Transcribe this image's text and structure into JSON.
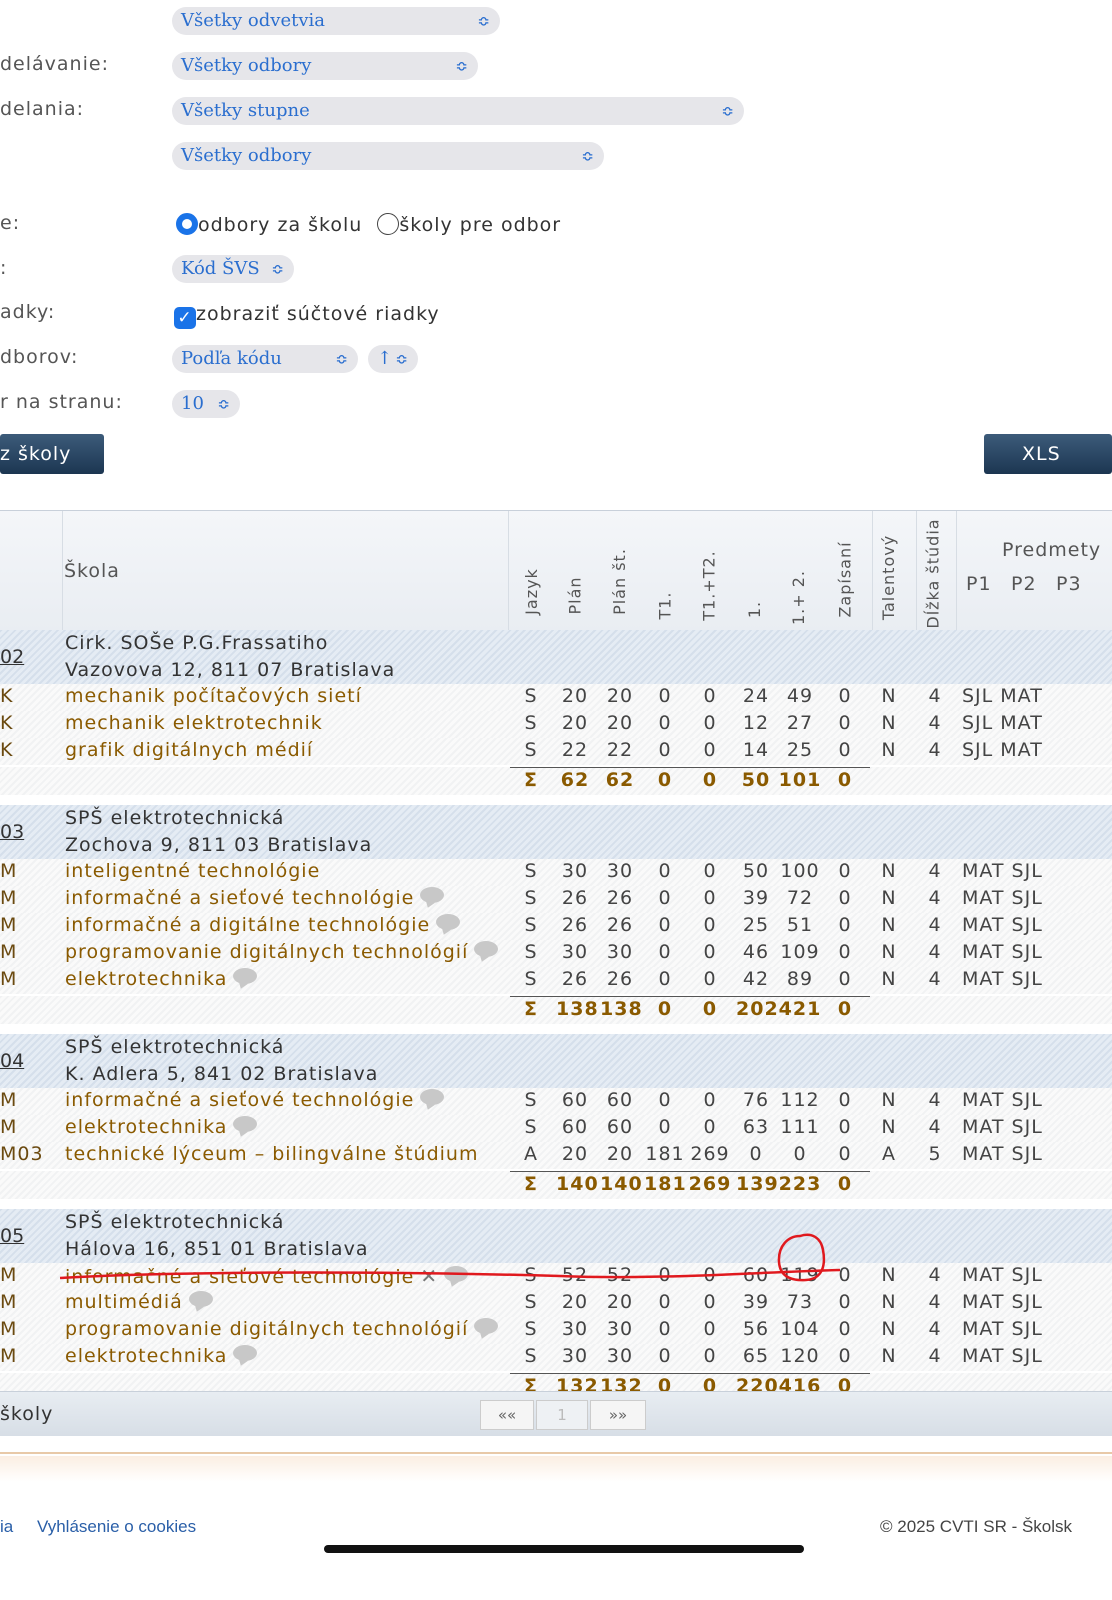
{
  "filters": {
    "select_odvetvia": "Všetky odvetvia",
    "label_vzdelavanie": "delávanie:",
    "select_odbory1": "Všetky odbory",
    "label_vzdelania": "delania:",
    "select_stupne": "Všetky stupne",
    "select_odbory2": "Všetky odbory",
    "label_zobrazenie": "e:",
    "radio1_label": "odbory za školu",
    "radio2_label": "školy pre odbor",
    "label_kod": ":",
    "select_kod": "Kód ŠVS",
    "label_riadky": "adky:",
    "checkbox_label": "zobraziť súčtové riadky",
    "label_odborov": "dborov:",
    "select_order": "Podľa kódu",
    "select_dir": "↑",
    "label_strana": "r na stranu:",
    "select_per_page": "10",
    "button_left": "z školy",
    "button_xls": "XLS"
  },
  "table": {
    "headers": {
      "skola": "Škola",
      "jazyk": "Jazyk",
      "plan": "Plán",
      "plan_st": "Plán št.",
      "t1": "T1.",
      "t1t2": "T1.+T2.",
      "k1": "1.",
      "k12": "1.+ 2.",
      "zapisani": "Zapísaní",
      "talentovy": "Talentový",
      "dlzka": "Dĺžka štúdia",
      "predmety": "Predmety",
      "p1": "P1",
      "p2": "P2",
      "p3": "P3"
    },
    "schools": [
      {
        "id": "02",
        "name": "Cirk. SOŠe P.G.Frassatiho",
        "address": "Vazovova 12, 811 07  Bratislava",
        "rows": [
          {
            "code": "K",
            "name": "mechanik počítačových sietí",
            "jazyk": "S",
            "plan": "20",
            "plan_st": "20",
            "t1": "0",
            "t1t2": "0",
            "k1": "24",
            "k12": "49",
            "zap": "0",
            "tal": "N",
            "dlzka": "4",
            "pred": "SJL MAT"
          },
          {
            "code": "K",
            "name": "mechanik elektrotechnik",
            "jazyk": "S",
            "plan": "20",
            "plan_st": "20",
            "t1": "0",
            "t1t2": "0",
            "k1": "12",
            "k12": "27",
            "zap": "0",
            "tal": "N",
            "dlzka": "4",
            "pred": "SJL MAT"
          },
          {
            "code": "K",
            "name": "grafik digitálnych médií",
            "jazyk": "S",
            "plan": "22",
            "plan_st": "22",
            "t1": "0",
            "t1t2": "0",
            "k1": "14",
            "k12": "25",
            "zap": "0",
            "tal": "N",
            "dlzka": "4",
            "pred": "SJL MAT"
          }
        ],
        "sum": {
          "sigma": "Σ",
          "plan": "62",
          "plan_st": "62",
          "t1": "0",
          "t1t2": "0",
          "k1": "50",
          "k12": "101",
          "zap": "0"
        }
      },
      {
        "id": "03",
        "name": "SPŠ elektrotechnická",
        "address": "Zochova 9, 811 03  Bratislava",
        "rows": [
          {
            "code": "M",
            "name": "inteligentné technológie",
            "jazyk": "S",
            "plan": "30",
            "plan_st": "30",
            "t1": "0",
            "t1t2": "0",
            "k1": "50",
            "k12": "100",
            "zap": "0",
            "tal": "N",
            "dlzka": "4",
            "pred": "MAT SJL"
          },
          {
            "code": "M",
            "name": "informačné a sieťové technológie",
            "jazyk": "S",
            "plan": "26",
            "plan_st": "26",
            "t1": "0",
            "t1t2": "0",
            "k1": "39",
            "k12": "72",
            "zap": "0",
            "tal": "N",
            "dlzka": "4",
            "pred": "MAT SJL"
          },
          {
            "code": "M",
            "name": "informačné a digitálne technológie",
            "jazyk": "S",
            "plan": "26",
            "plan_st": "26",
            "t1": "0",
            "t1t2": "0",
            "k1": "25",
            "k12": "51",
            "zap": "0",
            "tal": "N",
            "dlzka": "4",
            "pred": "MAT SJL"
          },
          {
            "code": "M",
            "name": "programovanie digitálnych technológií",
            "jazyk": "S",
            "plan": "30",
            "plan_st": "30",
            "t1": "0",
            "t1t2": "0",
            "k1": "46",
            "k12": "109",
            "zap": "0",
            "tal": "N",
            "dlzka": "4",
            "pred": "MAT SJL"
          },
          {
            "code": "M",
            "name": "elektrotechnika",
            "jazyk": "S",
            "plan": "26",
            "plan_st": "26",
            "t1": "0",
            "t1t2": "0",
            "k1": "42",
            "k12": "89",
            "zap": "0",
            "tal": "N",
            "dlzka": "4",
            "pred": "MAT SJL"
          }
        ],
        "sum": {
          "sigma": "Σ",
          "plan": "138",
          "plan_st": "138",
          "t1": "0",
          "t1t2": "0",
          "k1": "202",
          "k12": "421",
          "zap": "0"
        }
      },
      {
        "id": "04",
        "name": "SPŠ elektrotechnická",
        "address": "K. Adlera 5, 841 02  Bratislava",
        "rows": [
          {
            "code": "M",
            "name": "informačné a sieťové technológie",
            "jazyk": "S",
            "plan": "60",
            "plan_st": "60",
            "t1": "0",
            "t1t2": "0",
            "k1": "76",
            "k12": "112",
            "zap": "0",
            "tal": "N",
            "dlzka": "4",
            "pred": "MAT SJL"
          },
          {
            "code": "M",
            "name": "elektrotechnika",
            "jazyk": "S",
            "plan": "60",
            "plan_st": "60",
            "t1": "0",
            "t1t2": "0",
            "k1": "63",
            "k12": "111",
            "zap": "0",
            "tal": "N",
            "dlzka": "4",
            "pred": "MAT SJL"
          },
          {
            "code": "M03",
            "name": "technické lýceum – bilingválne štúdium",
            "jazyk": "A",
            "plan": "20",
            "plan_st": "20",
            "t1": "181",
            "t1t2": "269",
            "k1": "0",
            "k12": "0",
            "zap": "0",
            "tal": "A",
            "dlzka": "5",
            "pred": "MAT SJL"
          }
        ],
        "sum": {
          "sigma": "Σ",
          "plan": "140",
          "plan_st": "140",
          "t1": "181",
          "t1t2": "269",
          "k1": "139",
          "k12": "223",
          "zap": "0"
        }
      },
      {
        "id": "05",
        "name": "SPŠ elektrotechnická",
        "address": "Hálova 16, 851 01  Bratislava",
        "rows": [
          {
            "code": "M",
            "name": "informačné a sieťové technológie",
            "jazyk": "S",
            "plan": "52",
            "plan_st": "52",
            "t1": "0",
            "t1t2": "0",
            "k1": "60",
            "k12": "119",
            "zap": "0",
            "tal": "N",
            "dlzka": "4",
            "pred": "MAT SJL"
          },
          {
            "code": "M",
            "name": "multimédiá",
            "jazyk": "S",
            "plan": "20",
            "plan_st": "20",
            "t1": "0",
            "t1t2": "0",
            "k1": "39",
            "k12": "73",
            "zap": "0",
            "tal": "N",
            "dlzka": "4",
            "pred": "MAT SJL"
          },
          {
            "code": "M",
            "name": "programovanie digitálnych technológií",
            "jazyk": "S",
            "plan": "30",
            "plan_st": "30",
            "t1": "0",
            "t1t2": "0",
            "k1": "56",
            "k12": "104",
            "zap": "0",
            "tal": "N",
            "dlzka": "4",
            "pred": "MAT SJL"
          },
          {
            "code": "M",
            "name": "elektrotechnika",
            "jazyk": "S",
            "plan": "30",
            "plan_st": "30",
            "t1": "0",
            "t1t2": "0",
            "k1": "65",
            "k12": "120",
            "zap": "0",
            "tal": "N",
            "dlzka": "4",
            "pred": "MAT SJL"
          }
        ],
        "sum": {
          "sigma": "Σ",
          "plan": "132",
          "plan_st": "132",
          "t1": "0",
          "t1t2": "0",
          "k1": "220",
          "k12": "416",
          "zap": "0"
        }
      }
    ],
    "footer_label": "školy",
    "pager": {
      "first": "««",
      "page": "1",
      "last": "»»"
    }
  },
  "page_footer": {
    "link_left": "ia",
    "link_cookies": "Vyhlásenie o cookies",
    "copyright": "© 2025 CVTI SR - Školsk"
  },
  "colors": {
    "accent": "#1a73e8",
    "link": "#2a6ecf",
    "row_text": "#8a5a00",
    "button": "#2a4866",
    "annotation": "#e0191e"
  }
}
